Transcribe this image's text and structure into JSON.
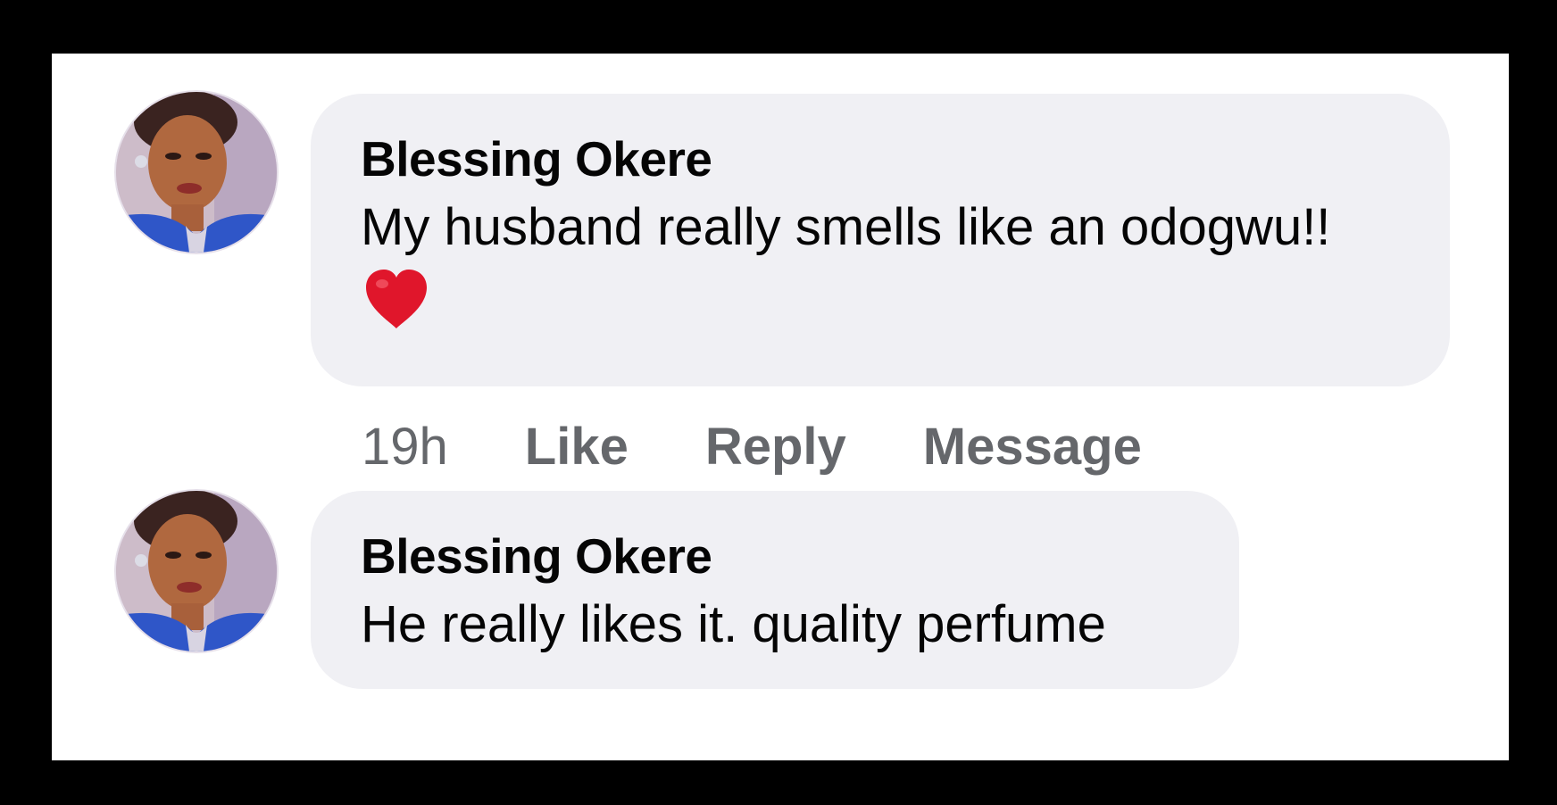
{
  "comments": [
    {
      "author": "Blessing Okere",
      "text": "My husband really smells like an odogwu!!",
      "emoji": "red-heart-icon",
      "time": "19h",
      "actions": [
        "Like",
        "Reply",
        "Message"
      ]
    },
    {
      "author": "Blessing Okere",
      "text": "He really likes it. quality perfume"
    }
  ],
  "colors": {
    "bubble": "#f0f0f4",
    "author": "#050505",
    "action": "#65676b",
    "heart": "#e0162b",
    "avatar_dress": "#2f56c8"
  }
}
